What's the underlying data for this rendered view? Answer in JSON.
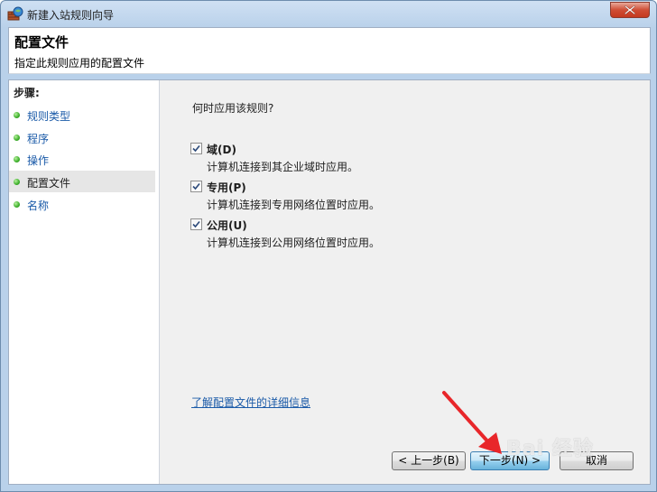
{
  "window": {
    "title": "新建入站规则向导"
  },
  "header": {
    "title": "配置文件",
    "subtitle": "指定此规则应用的配置文件"
  },
  "sidebar": {
    "title": "步骤:",
    "items": [
      {
        "label": "规则类型",
        "active": false
      },
      {
        "label": "程序",
        "active": false
      },
      {
        "label": "操作",
        "active": false
      },
      {
        "label": "配置文件",
        "active": true
      },
      {
        "label": "名称",
        "active": false
      }
    ]
  },
  "main": {
    "question": "何时应用该规则?",
    "options": [
      {
        "label": "域(D)",
        "description": "计算机连接到其企业域时应用。",
        "checked": true
      },
      {
        "label": "专用(P)",
        "description": "计算机连接到专用网络位置时应用。",
        "checked": true
      },
      {
        "label": "公用(U)",
        "description": "计算机连接到公用网络位置时应用。",
        "checked": true
      }
    ],
    "link": "了解配置文件的详细信息"
  },
  "buttons": {
    "back": "< 上一步(B)",
    "next": "下一步(N) >",
    "cancel": "取消"
  },
  "watermark": "Bai 经验",
  "colors": {
    "link": "#1a5aa8",
    "active_step_bg": "#e6e6e6",
    "arrow": "#e8262a"
  }
}
